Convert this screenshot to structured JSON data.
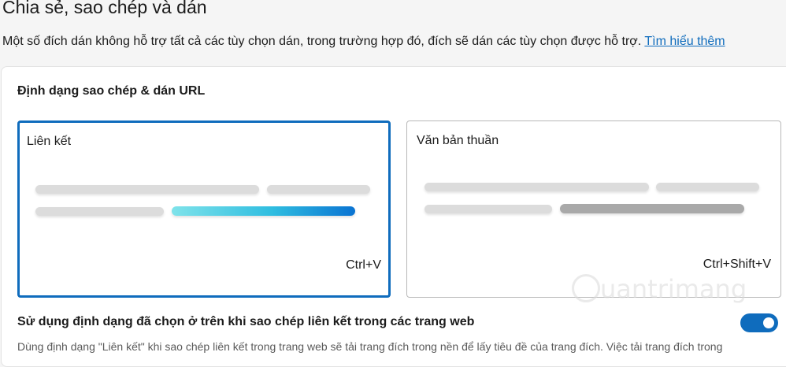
{
  "header": {
    "title": "Chia sẻ, sao chép và dán",
    "description": "Một số đích dán không hỗ trợ tất cả các tùy chọn dán, trong trường hợp đó, đích sẽ dán các tùy chọn được hỗ trợ.",
    "learn_more": "Tìm hiểu thêm"
  },
  "url_format": {
    "section_title": "Định dạng sao chép & dán URL",
    "options": [
      {
        "label": "Liên kết",
        "shortcut": "Ctrl+V",
        "selected": true
      },
      {
        "label": "Văn bản thuần",
        "shortcut": "Ctrl+Shift+V",
        "selected": false
      }
    ]
  },
  "toggle_setting": {
    "label": "Sử dụng định dạng đã chọn ở trên khi sao chép liên kết trong các trang web",
    "enabled": true,
    "hint": "Dùng định dạng \"Liên kết\" khi sao chép liên kết trong trang web sẽ tải trang đích trong nền để lấy tiêu đề của trang đích. Việc tải trang đích trong"
  },
  "watermark": {
    "text": "uantrimang"
  },
  "colors": {
    "accent": "#0f6cbd",
    "link": "#0f6cbd"
  }
}
